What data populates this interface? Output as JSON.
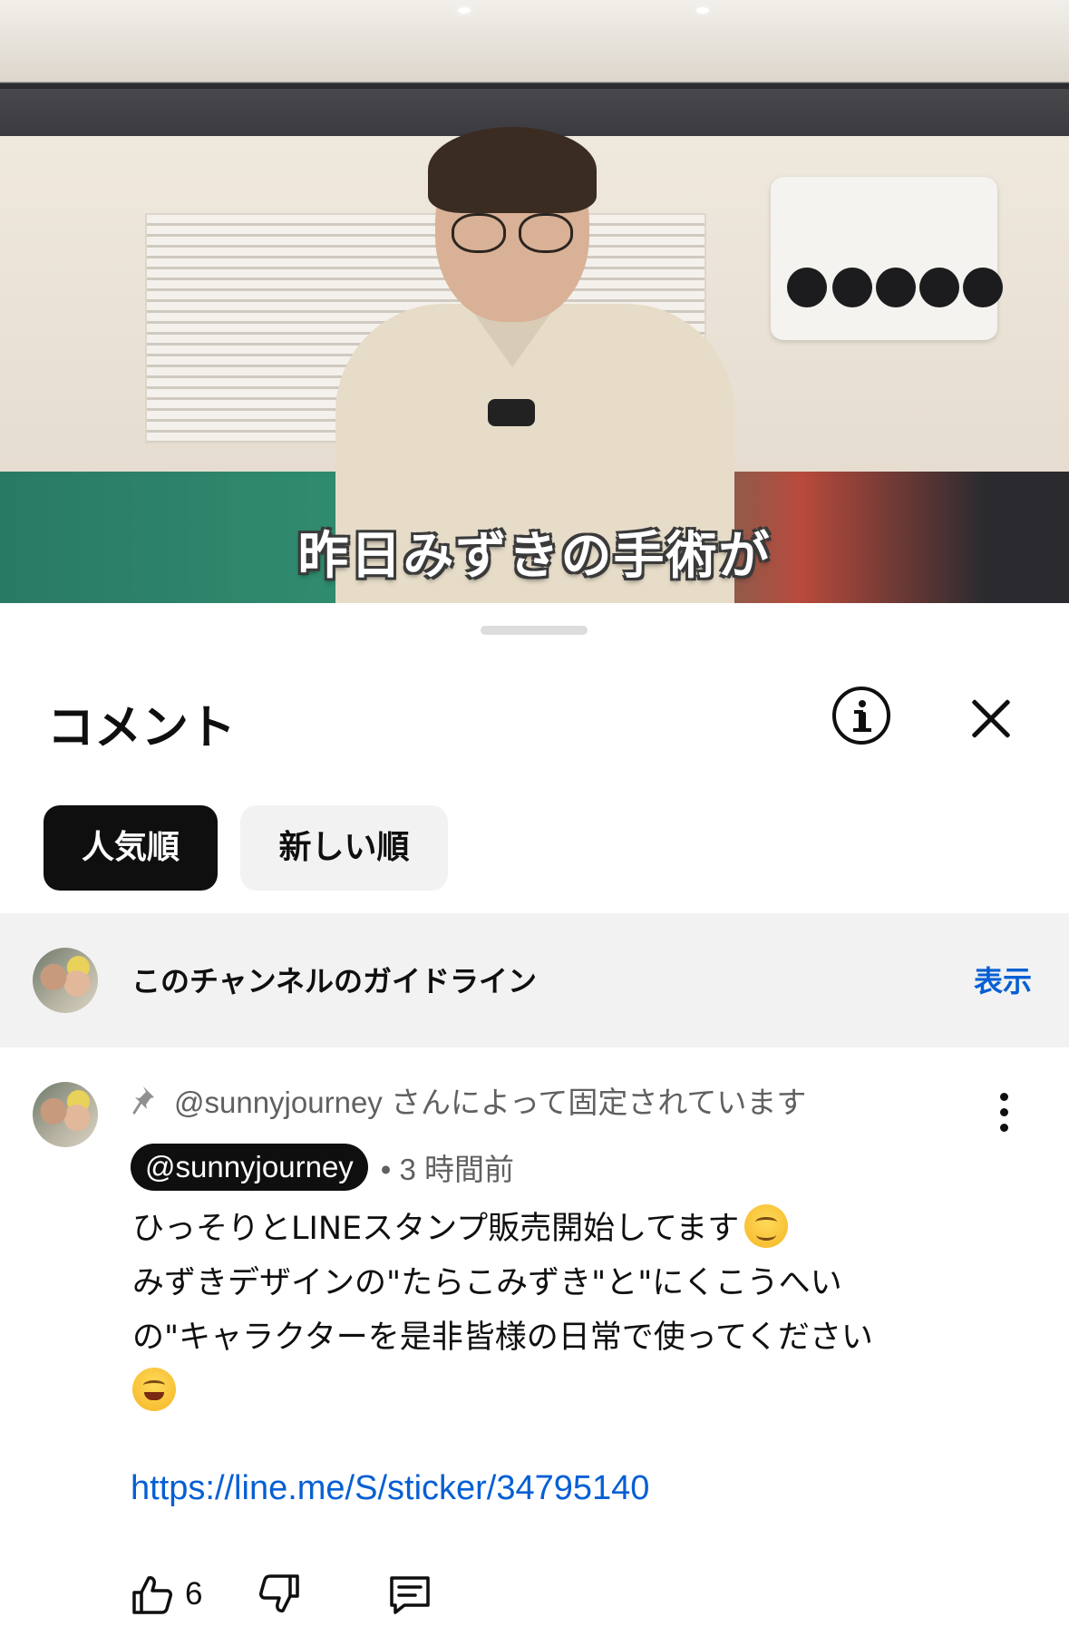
{
  "video": {
    "caption": "昨日みずきの手術が"
  },
  "sheet": {
    "title": "コメント",
    "info_icon": "info-circle-icon",
    "close_icon": "close-icon"
  },
  "sort": {
    "popular": "人気順",
    "newest": "新しい順",
    "selected": "人気順"
  },
  "guidelines": {
    "text": "このチャンネルのガイドライン",
    "action": "表示"
  },
  "comment": {
    "pinned_label": "@sunnyjourney さんによって固定されています",
    "author": "@sunnyjourney",
    "time": "• 3 時間前",
    "body_line1": "ひっそりとLINEスタンプ販売開始してます",
    "body_line2": "みずきデザインの\"たらこみずき\"と\"にくこうへい",
    "body_line3": "の\"キャラクターを是非皆様の日常で使ってください",
    "link": "https://line.me/S/sticker/34795140",
    "like_count": "6"
  },
  "colors": {
    "link": "#065fd4",
    "chip_selected_bg": "#0f0f0f",
    "chip_bg": "#f2f2f2",
    "guide_bg": "#f2f2f2",
    "secondary_text": "#606060"
  }
}
